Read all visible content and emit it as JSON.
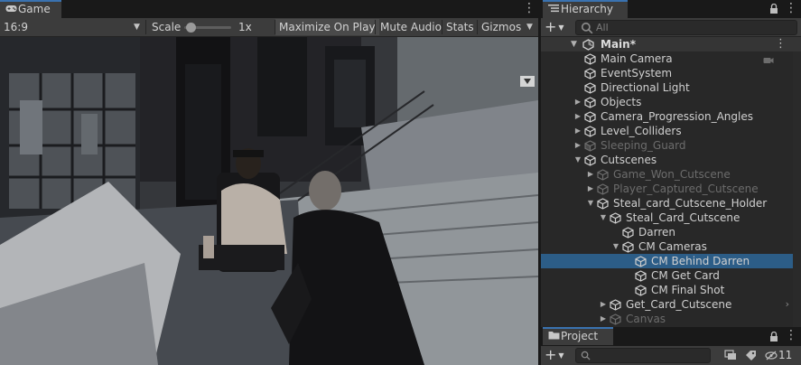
{
  "game": {
    "tab_label": "Game",
    "aspect_value": "16:9",
    "scale_label": "Scale",
    "scale_value": "1x",
    "scale_level": 0.05,
    "maximize_label": "Maximize On Play",
    "mute_label": "Mute Audio",
    "stats_label": "Stats",
    "gizmos_label": "Gizmos"
  },
  "hierarchy": {
    "tab_label": "Hierarchy",
    "search_placeholder": "All",
    "scene_name": "Main*",
    "rows": [
      {
        "label": "Main Camera"
      },
      {
        "label": "EventSystem"
      },
      {
        "label": "Directional Light"
      },
      {
        "label": "Objects"
      },
      {
        "label": "Camera_Progression_Angles"
      },
      {
        "label": "Level_Colliders"
      },
      {
        "label": "Sleeping_Guard"
      },
      {
        "label": "Cutscenes"
      },
      {
        "label": "Game_Won_Cutscene"
      },
      {
        "label": "Player_Captured_Cutscene"
      },
      {
        "label": "Steal_card_Cutscene_Holder"
      },
      {
        "label": "Steal_Card_Cutscene"
      },
      {
        "label": "Darren"
      },
      {
        "label": "CM Cameras"
      },
      {
        "label": "CM Behind Darren"
      },
      {
        "label": "CM Get Card"
      },
      {
        "label": "CM Final Shot"
      },
      {
        "label": "Get_Card_Cutscene"
      },
      {
        "label": "Canvas"
      }
    ]
  },
  "project": {
    "tab_label": "Project",
    "hidden_count": "11"
  },
  "colors": {
    "accent_tab_line": "#3a72b0",
    "selected_row": "#2c5d87",
    "panel_bg": "#282828",
    "toolbar_bg": "#3c3c3c"
  }
}
